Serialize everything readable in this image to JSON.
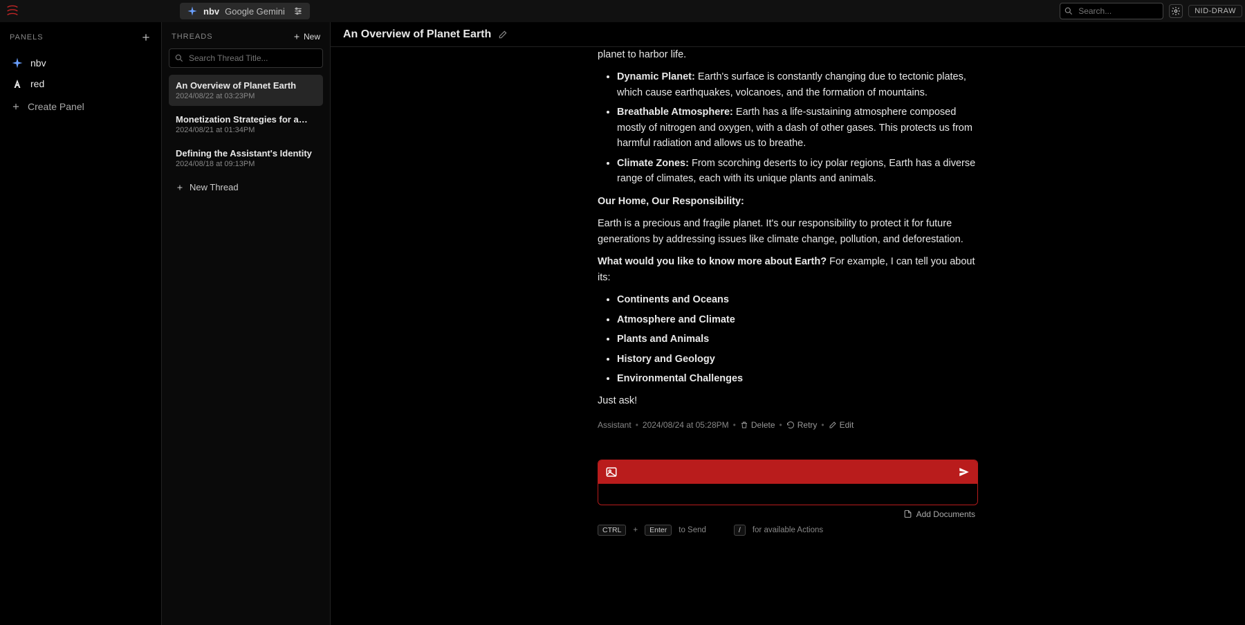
{
  "topbar": {
    "model_short": "nbv",
    "model_full": "Google Gemini",
    "search_placeholder": "Search...",
    "draw_badge": "NID-DRAW"
  },
  "panels": {
    "header": "PANELS",
    "items": [
      {
        "label": "nbv",
        "icon": "spark"
      },
      {
        "label": "red",
        "icon": "anthropic"
      }
    ],
    "create_label": "Create Panel"
  },
  "threads": {
    "header": "THREADS",
    "new_label": "New",
    "search_placeholder": "Search Thread Title...",
    "items": [
      {
        "title": "An Overview of Planet Earth",
        "ts": "2024/08/22 at 03:23PM",
        "active": true
      },
      {
        "title": "Monetization Strategies for a…",
        "ts": "2024/08/21 at 01:34PM",
        "active": false
      },
      {
        "title": "Defining the Assistant's Identity",
        "ts": "2024/08/18 at 09:13PM",
        "active": false
      }
    ],
    "new_thread_label": "New Thread"
  },
  "conversation": {
    "title": "An Overview of Planet Earth",
    "fragments": {
      "tail_line": "planet to harbor life.",
      "dynamic_label": "Dynamic Planet:",
      "dynamic_text": " Earth's surface is constantly changing due to tectonic plates, which cause earthquakes, volcanoes, and the formation of mountains.",
      "breath_label": "Breathable Atmosphere:",
      "breath_text": " Earth has a life-sustaining atmosphere composed mostly of nitrogen and oxygen, with a dash of other gases. This protects us from harmful radiation and allows us to breathe.",
      "climate_label": "Climate Zones:",
      "climate_text": " From scorching deserts to icy polar regions, Earth has a diverse range of climates, each with its unique plants and animals.",
      "responsibility_hdr": "Our Home, Our Responsibility:",
      "responsibility_body": "Earth is a precious and fragile planet. It's our responsibility to protect it for future generations by addressing issues like climate change, pollution, and deforestation.",
      "know_more_bold": "What would you like to know more about Earth?",
      "know_more_rest": " For example, I can tell you about its:",
      "topics": [
        "Continents and Oceans",
        "Atmosphere and Climate",
        "Plants and Animals",
        "History and Geology",
        "Environmental Challenges"
      ],
      "just_ask": "Just ask!"
    },
    "meta": {
      "role": "Assistant",
      "ts": "2024/08/24 at 05:28PM",
      "delete": "Delete",
      "retry": "Retry",
      "edit": "Edit"
    },
    "add_docs": "Add Documents",
    "hints": {
      "ctrl": "CTRL",
      "plus": "+",
      "enter": "Enter",
      "to_send": "to Send",
      "slash": "/",
      "for_actions": "for available Actions"
    }
  },
  "colors": {
    "accent_red": "#b91c1c"
  }
}
